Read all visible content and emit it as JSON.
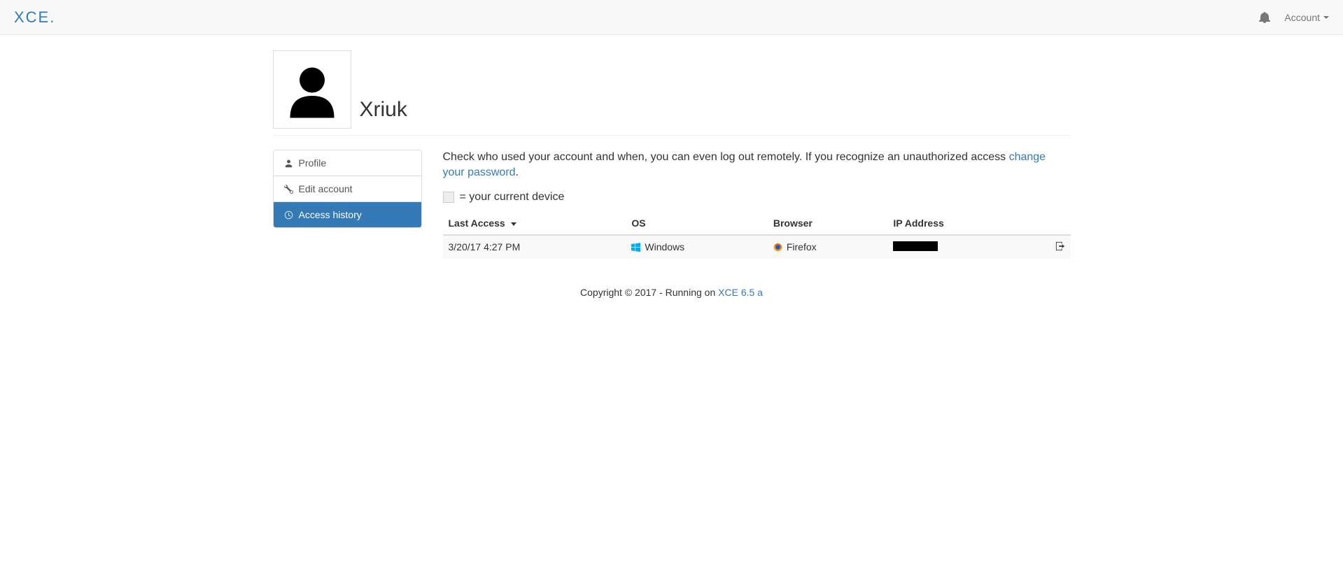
{
  "navbar": {
    "brand": "XCE.",
    "account_label": "Account"
  },
  "header": {
    "username": "Xriuk"
  },
  "sidebar": {
    "items": [
      {
        "label": "Profile",
        "icon": "user",
        "active": false
      },
      {
        "label": "Edit account",
        "icon": "wrench",
        "active": false
      },
      {
        "label": "Access history",
        "icon": "clock",
        "active": true
      }
    ]
  },
  "main": {
    "description_prefix": "Check who used your account and when, you can even log out remotely. If you recognize an unauthorized access ",
    "change_password_link": "change your password",
    "description_suffix": ".",
    "current_device_label": "= your current device",
    "table": {
      "columns": {
        "last_access": "Last Access",
        "os": "OS",
        "browser": "Browser",
        "ip": "IP Address"
      },
      "rows": [
        {
          "last_access": "3/20/17 4:27 PM",
          "os": "Windows",
          "browser": "Firefox",
          "ip": ""
        }
      ]
    }
  },
  "footer": {
    "copyright": "Copyright © 2017 - Running on ",
    "version_link": "XCE 6.5 a"
  }
}
